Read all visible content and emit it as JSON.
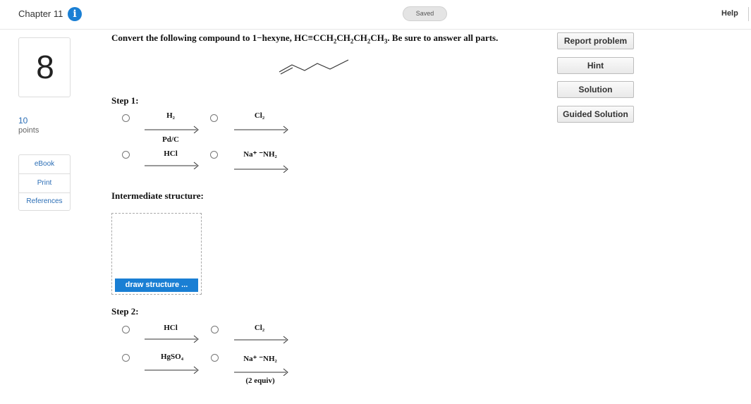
{
  "header": {
    "chapter": "Chapter 11",
    "status": "Saved",
    "help": "Help"
  },
  "question": {
    "number": "8",
    "points_value": "10",
    "points_label": "points"
  },
  "resources": [
    "eBook",
    "Print",
    "References"
  ],
  "prompt": {
    "lead": "Convert the following compound to 1−hexyne, HC≡CCH",
    "tail": ". Be sure to answer all parts."
  },
  "step1": {
    "label": "Step 1:",
    "options": [
      {
        "top": "H₂",
        "bottom": "Pd/C"
      },
      {
        "top": "Cl₂",
        "bottom": ""
      },
      {
        "top": "HCl",
        "bottom": ""
      },
      {
        "top": "Na⁺ ⁻NH₂",
        "bottom": ""
      }
    ]
  },
  "intermediate": {
    "label": "Intermediate structure:",
    "button": "draw structure ..."
  },
  "step2": {
    "label": "Step 2:",
    "options": [
      {
        "top": "HCl",
        "bottom": ""
      },
      {
        "top": "Cl₂",
        "bottom": ""
      },
      {
        "top": "HgSO₄",
        "bottom": ""
      },
      {
        "top": "Na⁺ ⁻NH₂",
        "bottom": "(2 equiv)"
      }
    ]
  },
  "sidebar_buttons": [
    "Report problem",
    "Hint",
    "Solution",
    "Guided Solution"
  ],
  "colors": {
    "accent": "#1a7fd4",
    "link": "#2a6db5"
  },
  "icons": {
    "info": "info-icon"
  }
}
